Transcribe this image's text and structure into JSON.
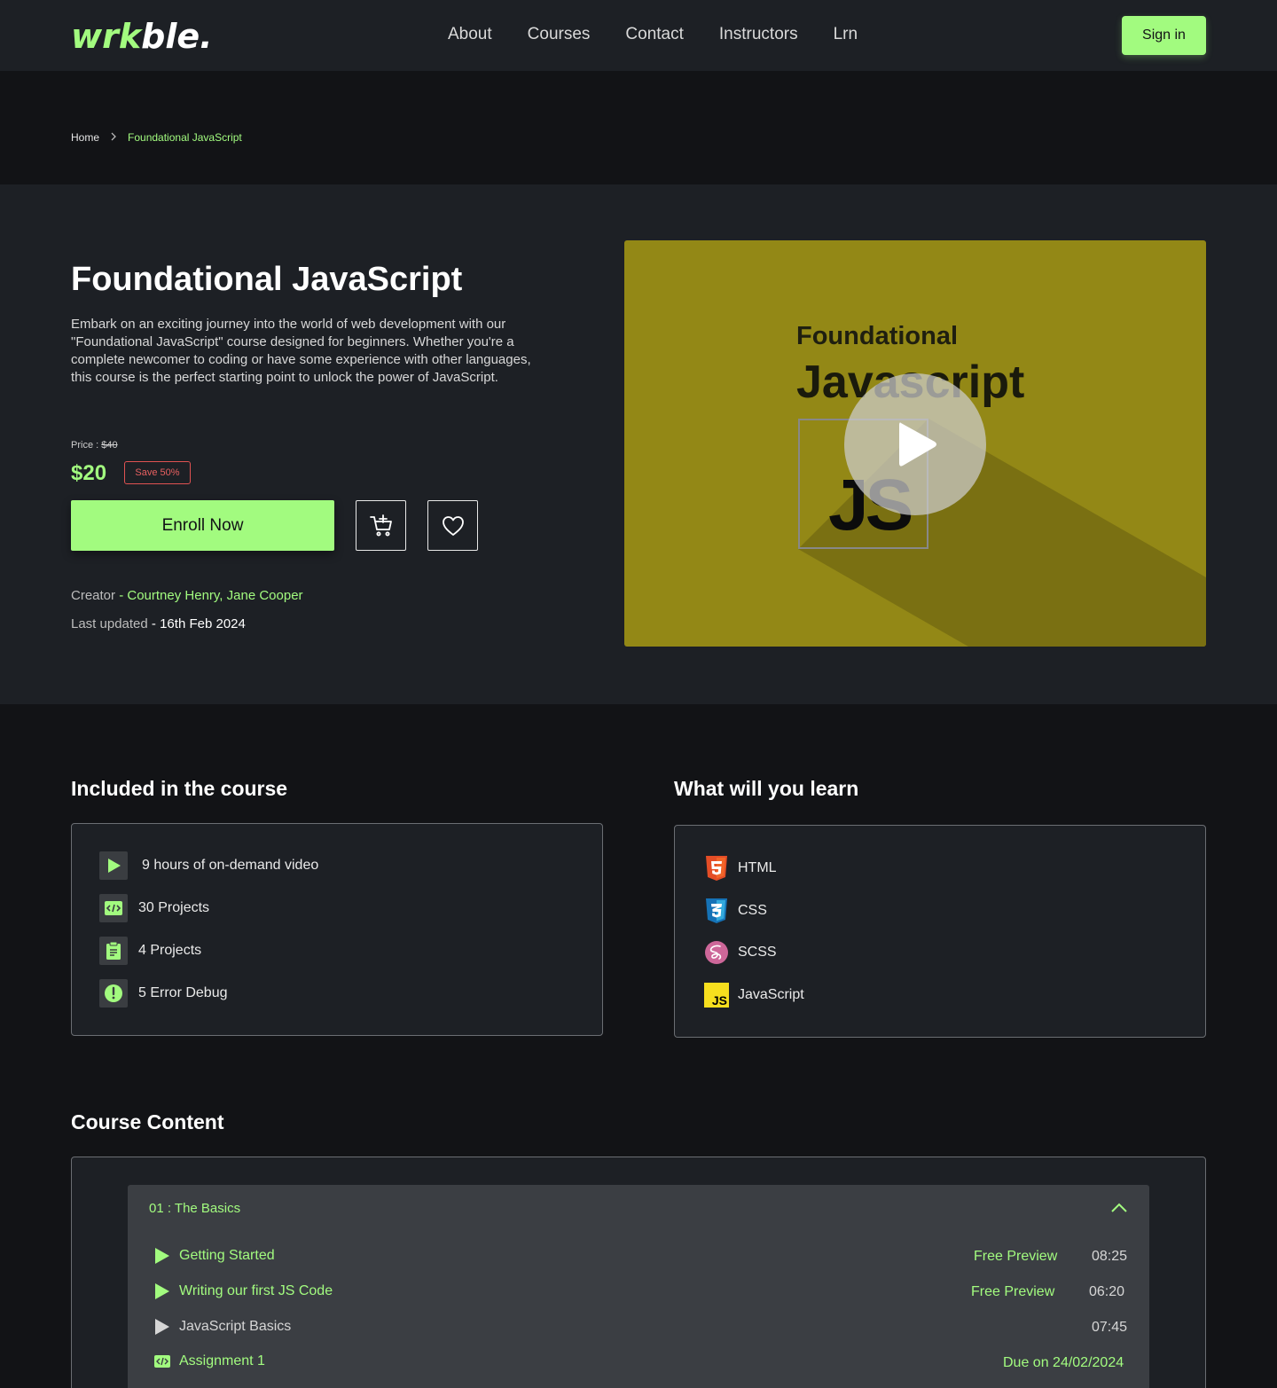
{
  "brand": {
    "logo_part1": "wrk",
    "logo_part2": "ble.",
    "accent": "#a2fb7f"
  },
  "nav": {
    "links": [
      "About",
      "Courses",
      "Contact",
      "Instructors",
      "Lrn"
    ],
    "signin_label": "Sign in"
  },
  "breadcrumb": {
    "home": "Home",
    "current": "Foundational JavaScript"
  },
  "course": {
    "title": "Foundational JavaScript",
    "description": "Embark on an exciting journey into the world of web development with our \"Foundational JavaScript\" course designed for beginners. Whether you're a complete newcomer to coding or have some experience with other languages, this course is the perfect starting point to unlock the power of JavaScript.",
    "price_label": "Price : ",
    "original_price": "$40",
    "price": "$20",
    "save_badge": "Save 50%",
    "enroll_label": "Enroll Now",
    "creator_label": "Creator",
    "creator_sep": " - ",
    "creators": "Courtney Henry, Jane Cooper",
    "updated_label": "Last updated",
    "updated_sep": " - ",
    "updated_value": "16th Feb 2024",
    "thumb_line1": "Foundational",
    "thumb_line2": "Javascript",
    "thumb_badge": "JS"
  },
  "included": {
    "heading": "Included in the course",
    "items": [
      {
        "icon": "play-icon",
        "text": "9 hours of on-demand video"
      },
      {
        "icon": "code-icon",
        "text": "30 Projects"
      },
      {
        "icon": "clipboard-icon",
        "text": "4 Projects"
      },
      {
        "icon": "alert-icon",
        "text": "5 Error Debug"
      }
    ]
  },
  "learn": {
    "heading": "What will you learn",
    "items": [
      {
        "icon": "html5-icon",
        "text": "HTML"
      },
      {
        "icon": "css3-icon",
        "text": "CSS"
      },
      {
        "icon": "sass-icon",
        "text": "SCSS"
      },
      {
        "icon": "javascript-icon",
        "text": "JavaScript"
      }
    ]
  },
  "content": {
    "heading": "Course Content",
    "section_title": "01 : The Basics",
    "lessons": [
      {
        "icon": "play-icon",
        "title": "Getting Started",
        "preview": "Free Preview",
        "duration": "08:25"
      },
      {
        "icon": "play-icon",
        "title": "Writing our first JS Code",
        "preview": "Free Preview",
        "duration": "06:20"
      },
      {
        "icon": "play-icon",
        "title": "JavaScript Basics",
        "preview": "",
        "duration": "07:45"
      },
      {
        "icon": "code-icon",
        "title": "Assignment 1",
        "preview": "",
        "duration": "Due on 24/02/2024"
      }
    ]
  }
}
